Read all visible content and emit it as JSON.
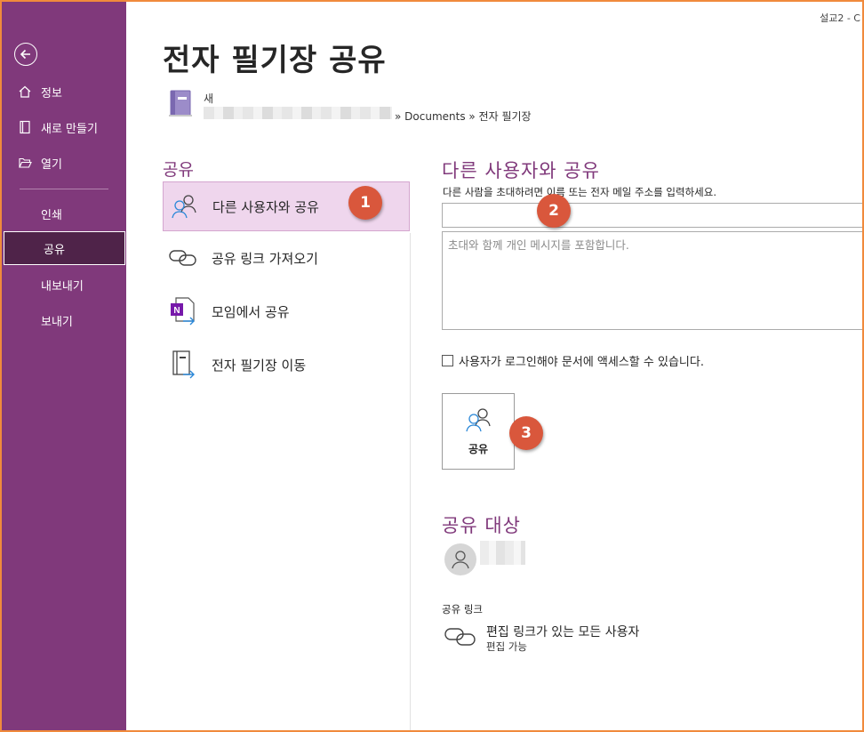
{
  "window": {
    "top_right_text": "설교2  -  C"
  },
  "sidebar": {
    "bg_color": "#80397b",
    "back_icon": "back-arrow-icon",
    "items": [
      {
        "label": "정보",
        "icon": "home-icon"
      },
      {
        "label": "새로 만들기",
        "icon": "new-notebook-icon"
      },
      {
        "label": "열기",
        "icon": "folder-open-icon"
      },
      {
        "label": "인쇄"
      },
      {
        "label": "공유",
        "active": true
      },
      {
        "label": "내보내기"
      },
      {
        "label": "보내기"
      }
    ]
  },
  "header": {
    "title": "전자 필기장 공유",
    "notebook_name": "새",
    "notebook_path_suffix": "» Documents » 전자 필기장"
  },
  "share_options": {
    "title": "공유",
    "items": [
      {
        "label": "다른 사용자와 공유",
        "icon": "people-icon",
        "selected": true
      },
      {
        "label": "공유 링크 가져오기",
        "icon": "link-icon"
      },
      {
        "label": "모임에서 공유",
        "icon": "onenote-meeting-icon"
      },
      {
        "label": "전자 필기장 이동",
        "icon": "move-notebook-icon"
      }
    ]
  },
  "share_panel": {
    "title": "다른 사용자와 공유",
    "instruction": "다른 사람을 초대하려면 이름 또는 전자 메일 주소를 입력하세요.",
    "invite_value": "",
    "message_placeholder": "초대와 함께 개인 메시지를 포함합니다.",
    "require_signin_label": "사용자가 로그인해야 문서에 액세스할 수 있습니다.",
    "require_signin_checked": false,
    "share_button_label": "공유"
  },
  "shared_with": {
    "title": "공유 대상",
    "link_section_label": "공유 링크",
    "link_title": "편집 링크가 있는 모든 사용자",
    "link_permission": "편집 가능"
  },
  "callouts": [
    "1",
    "2",
    "3"
  ],
  "accent_color": "#80397b",
  "callout_color": "#d9573c"
}
